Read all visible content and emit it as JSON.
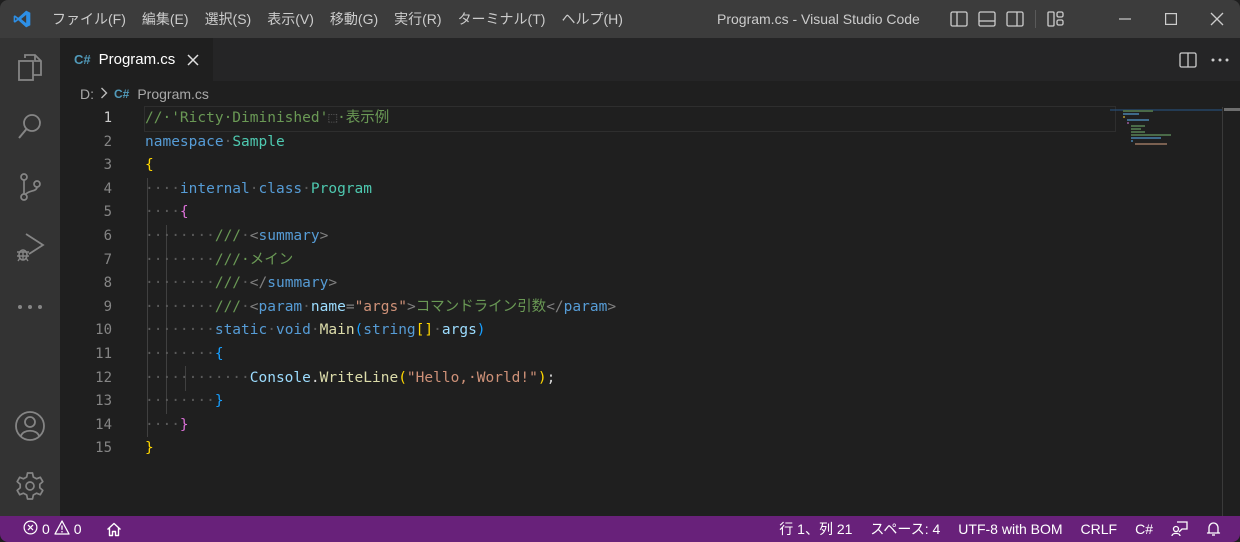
{
  "titlebar": {
    "menu": [
      "ファイル(F)",
      "編集(E)",
      "選択(S)",
      "表示(V)",
      "移動(G)",
      "実行(R)",
      "ターミナル(T)",
      "ヘルプ(H)"
    ],
    "window_title": "Program.cs - Visual Studio Code"
  },
  "activity_bar": {
    "items": [
      "explorer-icon",
      "search-icon",
      "source-control-icon",
      "run-debug-icon",
      "more-icon"
    ],
    "bottom_items": [
      "account-icon",
      "settings-gear-icon"
    ]
  },
  "tabs": [
    {
      "language_badge": "C#",
      "label": "Program.cs",
      "active": true
    }
  ],
  "breadcrumb": {
    "drive": "D:",
    "language_badge": "C#",
    "file": "Program.cs"
  },
  "editor": {
    "line_numbers": [
      "1",
      "2",
      "3",
      "4",
      "5",
      "6",
      "7",
      "8",
      "9",
      "10",
      "11",
      "12",
      "13",
      "14",
      "15"
    ],
    "active_line": 1,
    "lines": {
      "l1_comment": "//·'Ricty·Diminished'",
      "l1_fullwidth_space": "⬚",
      "l1_comment_end": "·表示例",
      "l2_namespace_kw": "namespace",
      "l2_namespace_name": "Sample",
      "l3_brace": "{",
      "l4_internal": "internal",
      "l4_class": "class",
      "l4_classname": "Program",
      "l5_brace": "{",
      "l6_doc": "///",
      "l6_tag": "summary",
      "l7_doc": "///·メイン",
      "l8_doc": "///",
      "l8_tag": "summary",
      "l9_doc": "///",
      "l9_tag": "param",
      "l9_attr": "name",
      "l9_value": "\"args\"",
      "l9_text": "コマンドライン引数",
      "l9_endtag": "param",
      "l10_static": "static",
      "l10_void": "void",
      "l10_main": "Main",
      "l10_string": "string",
      "l10_brackets": "[]",
      "l10_args": "args",
      "l11_brace": "{",
      "l12_console": "Console",
      "l12_writeline": "WriteLine",
      "l12_string": "\"Hello,·World!\"",
      "l13_brace": "}",
      "l14_brace": "}",
      "l15_brace": "}"
    }
  },
  "statusbar": {
    "errors": "0",
    "warnings": "0",
    "cursor_position": "行 1、列 21",
    "indentation": "スペース: 4",
    "encoding": "UTF-8 with BOM",
    "eol": "CRLF",
    "language": "C#"
  },
  "colors": {
    "statusbar_bg": "#68217a",
    "titlebar_bg": "#3c3c3c",
    "editor_bg": "#1f1f1f",
    "activitybar_bg": "#333333",
    "csharp_badge": "#519aba"
  }
}
